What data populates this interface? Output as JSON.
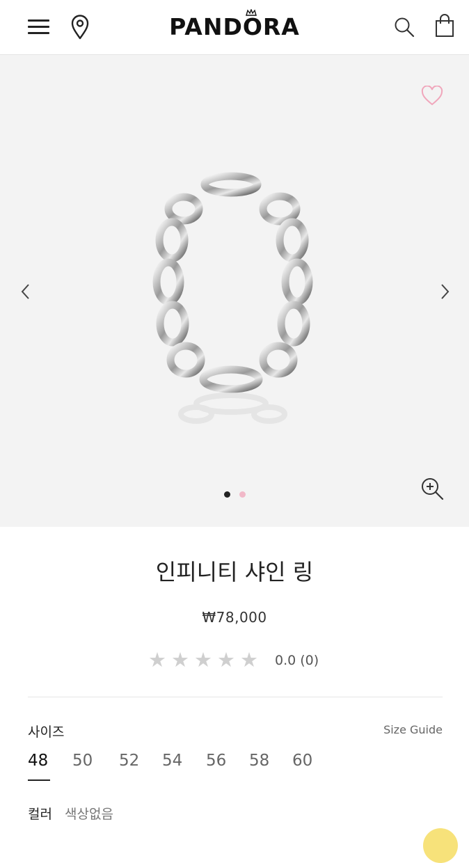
{
  "header": {
    "brand": "PANDORA",
    "icons": [
      "menu-icon",
      "location-pin-icon",
      "search-icon",
      "shopping-bag-icon"
    ]
  },
  "gallery": {
    "icons": [
      "heart-icon",
      "chevron-left-icon",
      "chevron-right-icon",
      "zoom-in-icon"
    ],
    "current_slide": 1,
    "total_slides": 2,
    "colors": {
      "background": "#f3f3f3",
      "active_dot": "#222222",
      "inactive_dot": "#f1b8c8",
      "heart": "#f0a6bb"
    }
  },
  "product": {
    "title": "인피니티 샤인 링",
    "price": "₩78,000",
    "rating": {
      "stars_filled": 0,
      "stars_total": 5,
      "text": "0.0 (0)"
    }
  },
  "size": {
    "label": "사이즈",
    "guide_link": "Size Guide",
    "options": [
      "48",
      "50",
      "52",
      "54",
      "56",
      "58",
      "60"
    ],
    "selected": "48"
  },
  "color": {
    "label": "컬러",
    "value": "색상없음"
  }
}
